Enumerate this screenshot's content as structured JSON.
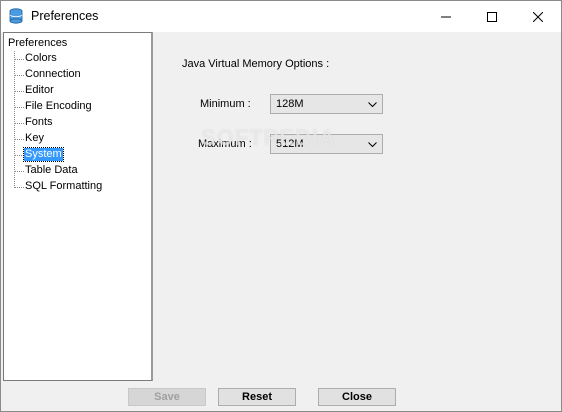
{
  "window": {
    "title": "Preferences",
    "icon": "database-icon",
    "controls": [
      "minimize-icon",
      "maximize-icon",
      "close-icon"
    ]
  },
  "tree": {
    "root": "Preferences",
    "items": [
      {
        "label": "Colors",
        "selected": false
      },
      {
        "label": "Connection",
        "selected": false
      },
      {
        "label": "Editor",
        "selected": false
      },
      {
        "label": "File Encoding",
        "selected": false
      },
      {
        "label": "Fonts",
        "selected": false
      },
      {
        "label": "Key",
        "selected": false
      },
      {
        "label": "System",
        "selected": true
      },
      {
        "label": "Table Data",
        "selected": false
      },
      {
        "label": "SQL Formatting",
        "selected": false
      }
    ]
  },
  "system": {
    "section_label": "Java Virtual Memory Options :",
    "minimum_label": "Minimum :",
    "minimum_value": "128M",
    "maximum_label": "Maximum :",
    "maximum_value": "512M"
  },
  "watermark": "SOFTPEDIA",
  "buttons": {
    "save": "Save",
    "reset": "Reset",
    "close": "Close"
  },
  "colors": {
    "selection": "#3399ff",
    "window_bg": "#f0f0f0"
  }
}
